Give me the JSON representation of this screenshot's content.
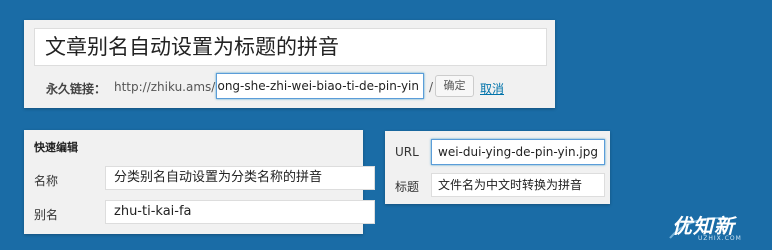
{
  "post": {
    "title": "文章别名自动设置为标题的拼音",
    "permalink_label": "永久链接：",
    "permalink_base": "http://zhiku.ams/",
    "slug": "zi-dong-she-zhi-wei-biao-ti-de-pin-yin",
    "slash": "/",
    "ok_button": "确定",
    "cancel_link": "取消"
  },
  "quick_edit": {
    "heading": "快速编辑",
    "name_label": "名称",
    "name_value": "分类别名自动设置为分类名称的拼音",
    "slug_label": "别名",
    "slug_value": "zhu-ti-kai-fa"
  },
  "media": {
    "url_label": "URL",
    "url_value": "wei-dui-ying-de-pin-yin.jpg",
    "title_label": "标题",
    "title_value": "文件名为中文时转换为拼音"
  },
  "watermark": {
    "brand": "优知新",
    "domain": "UZHIX.COM"
  }
}
